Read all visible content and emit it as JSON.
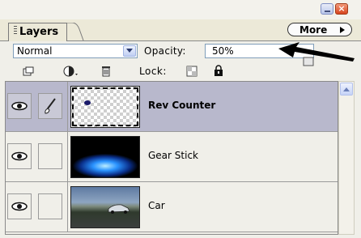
{
  "panel": {
    "tab_label": "Layers",
    "more_label": "More"
  },
  "blend": {
    "mode": "Normal",
    "opacity_label": "Opacity:",
    "opacity_value": "50%"
  },
  "lock": {
    "label": "Lock:"
  },
  "layers": [
    {
      "name": "Rev Counter",
      "selected": true,
      "visible": true
    },
    {
      "name": "Gear Stick",
      "selected": false,
      "visible": true
    },
    {
      "name": "Car",
      "selected": false,
      "visible": true
    }
  ],
  "icons": {
    "minimize": "minimize-icon",
    "close": "close-icon",
    "close_glyph": "×",
    "eye": "eye-icon",
    "brush": "brush-icon",
    "new_layer": "new-layer-icon",
    "adjustment": "adjustment-icon",
    "trash": "trash-icon",
    "lock_transparent": "lock-transparent-icon",
    "lock_all": "lock-all-icon"
  },
  "colors": {
    "selected_row": "#b8b8cc",
    "panel_bg": "#f0efe9",
    "close_red": "#d7441e"
  }
}
